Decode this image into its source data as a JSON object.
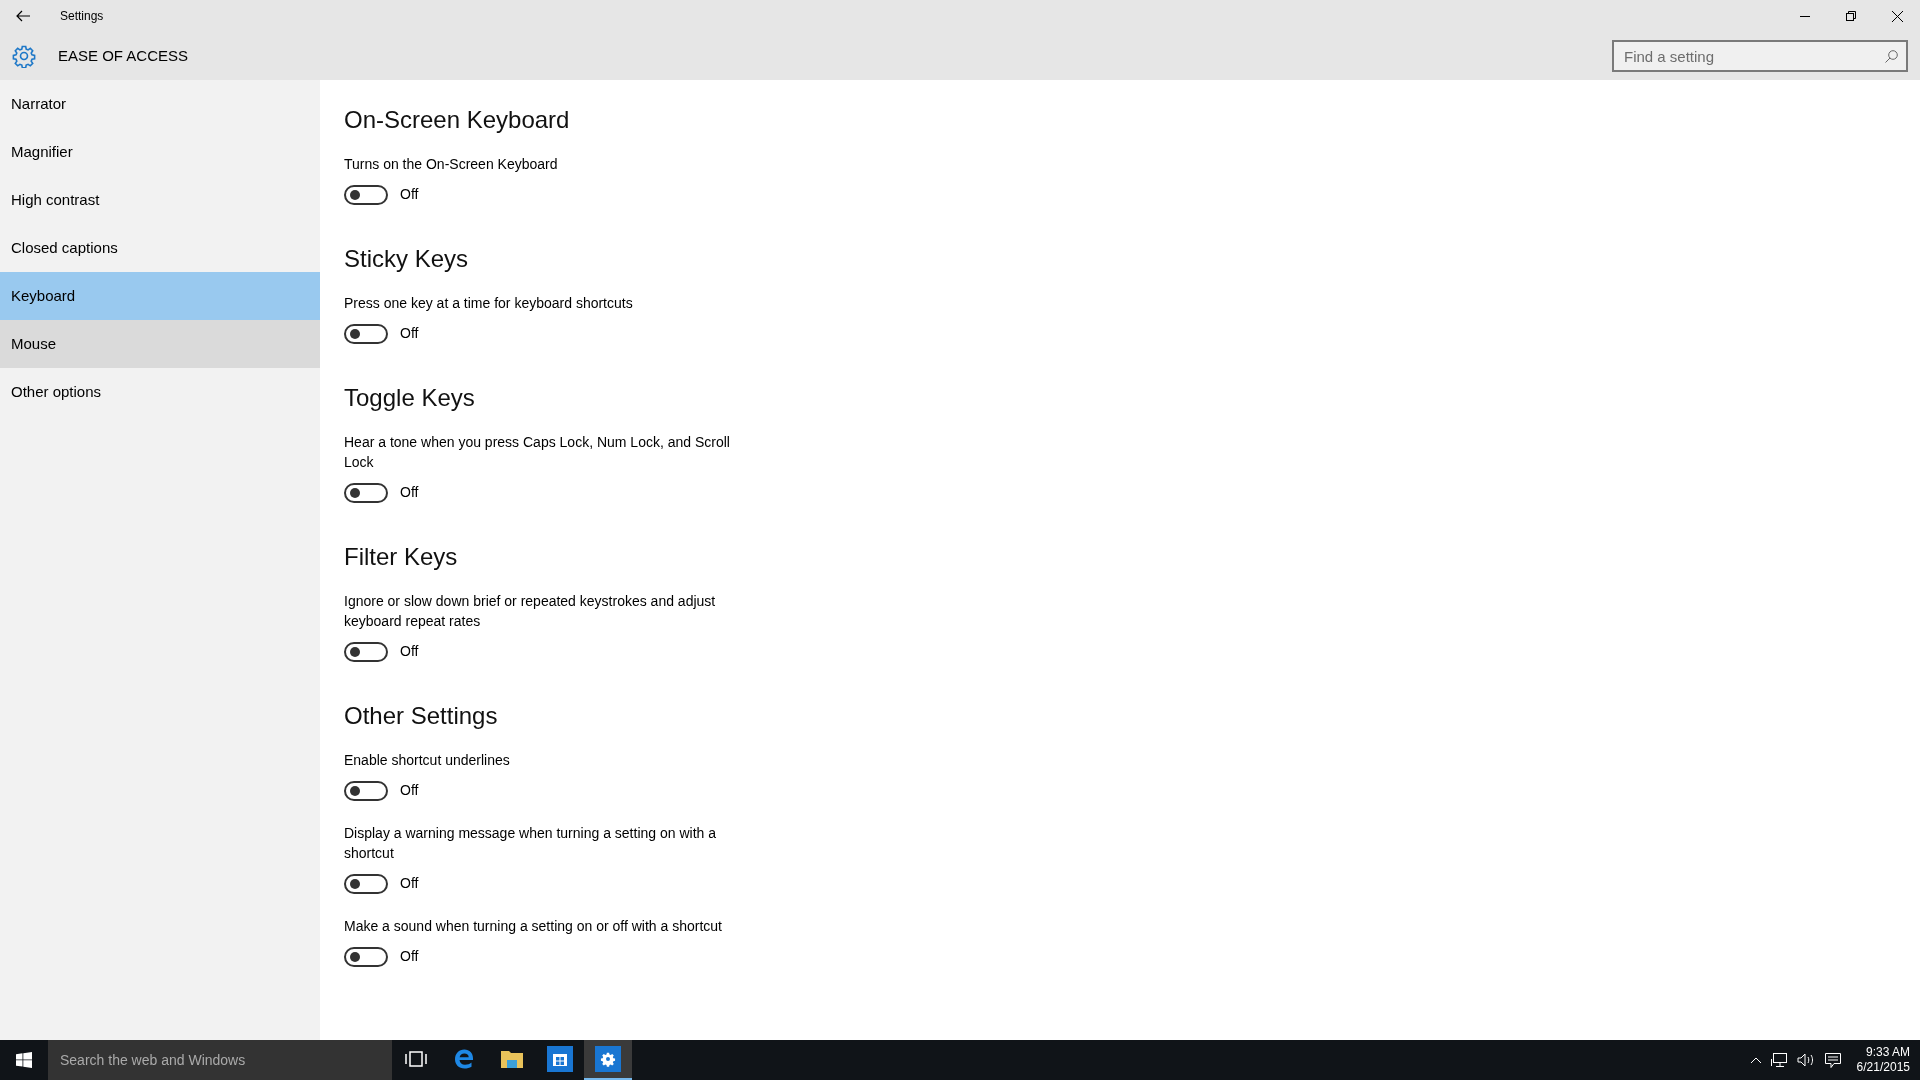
{
  "window": {
    "title": "Settings"
  },
  "header": {
    "title": "EASE OF ACCESS",
    "search": {
      "placeholder": "Find a setting"
    }
  },
  "sidebar": {
    "items": [
      {
        "label": "Narrator",
        "selected": false,
        "hovered": false
      },
      {
        "label": "Magnifier",
        "selected": false,
        "hovered": false
      },
      {
        "label": "High contrast",
        "selected": false,
        "hovered": false
      },
      {
        "label": "Closed captions",
        "selected": false,
        "hovered": false
      },
      {
        "label": "Keyboard",
        "selected": true,
        "hovered": false
      },
      {
        "label": "Mouse",
        "selected": false,
        "hovered": true
      },
      {
        "label": "Other options",
        "selected": false,
        "hovered": false
      }
    ]
  },
  "sections": [
    {
      "heading": "On-Screen Keyboard",
      "settings": [
        {
          "description": "Turns on the On-Screen Keyboard",
          "on": false,
          "state_label": "Off"
        }
      ]
    },
    {
      "heading": "Sticky Keys",
      "settings": [
        {
          "description": "Press one key at a time for keyboard shortcuts",
          "on": false,
          "state_label": "Off"
        }
      ]
    },
    {
      "heading": "Toggle Keys",
      "settings": [
        {
          "description": "Hear a tone when you press Caps Lock, Num Lock, and Scroll Lock",
          "on": false,
          "state_label": "Off"
        }
      ]
    },
    {
      "heading": "Filter Keys",
      "settings": [
        {
          "description": "Ignore or slow down brief or repeated keystrokes and adjust keyboard repeat rates",
          "on": false,
          "state_label": "Off"
        }
      ]
    },
    {
      "heading": "Other Settings",
      "settings": [
        {
          "description": "Enable shortcut underlines",
          "on": false,
          "state_label": "Off"
        },
        {
          "description": "Display a warning message when turning a setting on with a shortcut",
          "on": false,
          "state_label": "Off"
        },
        {
          "description": "Make a sound when turning a setting on or off with a shortcut",
          "on": false,
          "state_label": "Off"
        }
      ]
    }
  ],
  "taskbar": {
    "search": {
      "placeholder": "Search the web and Windows"
    },
    "apps": [
      {
        "kind": "task-view",
        "selected": false
      },
      {
        "kind": "browser",
        "selected": false
      },
      {
        "kind": "folder",
        "selected": false
      },
      {
        "kind": "store",
        "selected": false
      },
      {
        "kind": "settings",
        "selected": true
      }
    ],
    "clock": {
      "time": "9:33 AM",
      "date": "6/21/2015"
    }
  }
}
